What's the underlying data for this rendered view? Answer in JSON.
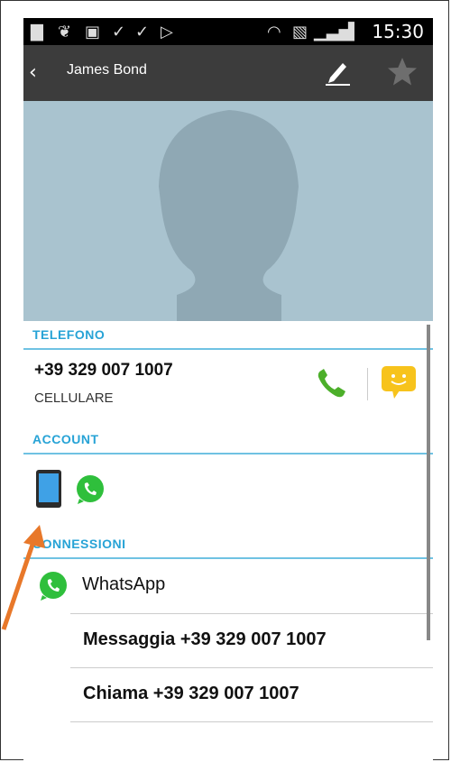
{
  "status_bar": {
    "time": "15:30"
  },
  "action_bar": {
    "title": "James Bond"
  },
  "sections": {
    "telefono": "TELEFONO",
    "account": "ACCOUNT",
    "connessioni": "CONNESSIONI"
  },
  "phone": {
    "number": "+39 329 007 1007",
    "type": "CELLULARE"
  },
  "connections": {
    "app_name": "WhatsApp",
    "message_action": "Messaggia +39 329 007 1007",
    "call_action": "Chiama +39 329 007 1007"
  },
  "colors": {
    "section_header": "#27a3d6",
    "divider": "#6fc2e3",
    "call_green": "#4caf2a",
    "sms_yellow": "#f7c31c",
    "whatsapp_green": "#2fbf3c"
  }
}
